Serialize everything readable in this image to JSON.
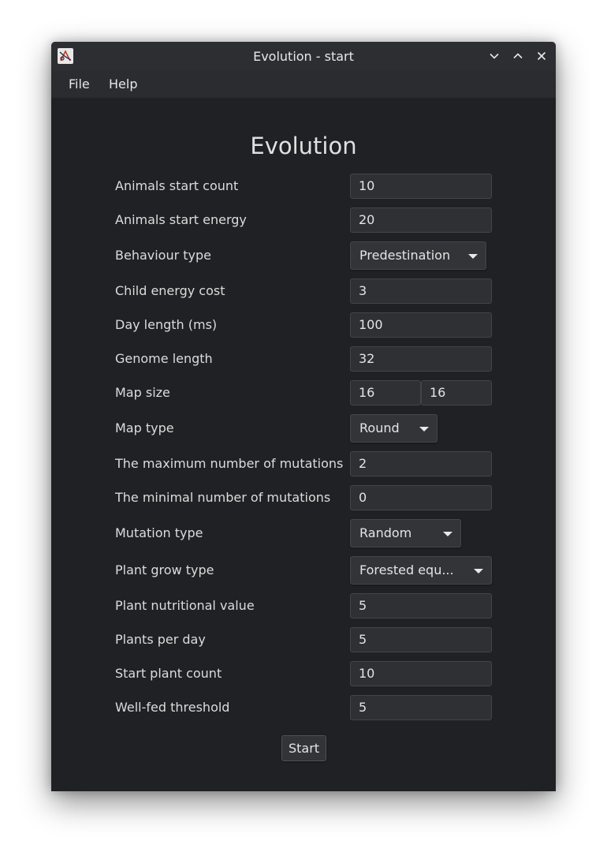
{
  "window": {
    "title": "Evolution - start"
  },
  "menu": {
    "items": [
      "File",
      "Help"
    ]
  },
  "form": {
    "heading": "Evolution",
    "animals_start_count": {
      "label": "Animals start count",
      "value": "10"
    },
    "animals_start_energy": {
      "label": "Animals start energy",
      "value": "20"
    },
    "behaviour_type": {
      "label": "Behaviour type",
      "selected": "Predestination"
    },
    "child_energy_cost": {
      "label": "Child energy cost",
      "value": "3"
    },
    "day_length": {
      "label": "Day length (ms)",
      "value": "100"
    },
    "genome_length": {
      "label": "Genome length",
      "value": "32"
    },
    "map_size": {
      "label": "Map size",
      "width": "16",
      "height": "16"
    },
    "map_type": {
      "label": "Map type",
      "selected": "Round"
    },
    "max_mutations": {
      "label": "The maximum number of mutations",
      "value": "2"
    },
    "min_mutations": {
      "label": "The minimal number of mutations",
      "value": "0"
    },
    "mutation_type": {
      "label": "Mutation type",
      "selected": "Random"
    },
    "plant_grow_type": {
      "label": "Plant grow type",
      "selected": "Forested equ..."
    },
    "plant_nutritional_value": {
      "label": "Plant nutritional value",
      "value": "5"
    },
    "plants_per_day": {
      "label": "Plants per day",
      "value": "5"
    },
    "start_plant_count": {
      "label": "Start plant count",
      "value": "10"
    },
    "well_fed_threshold": {
      "label": "Well-fed threshold",
      "value": "5"
    },
    "start_label": "Start"
  }
}
